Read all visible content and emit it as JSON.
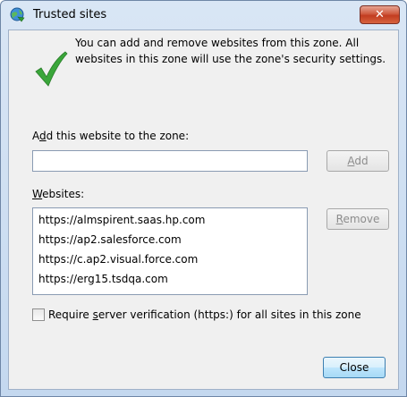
{
  "window": {
    "title": "Trusted sites",
    "close_glyph": "✕",
    "icon": "trusted-sites-globe-icon"
  },
  "info": {
    "icon": "green-checkmark-icon",
    "text": "You can add and remove websites from this zone. All websites in this zone will use the zone's security settings."
  },
  "add_section": {
    "label_accel": "d",
    "label_pre": "A",
    "label_post": "d this website to the zone:",
    "input_value": "",
    "add_button_pre": "",
    "add_button_accel": "A",
    "add_button_post": "dd"
  },
  "websites_section": {
    "label_accel": "W",
    "label_post": "ebsites:",
    "items": [
      "https://almspirent.saas.hp.com",
      "https://ap2.salesforce.com",
      "https://c.ap2.visual.force.com",
      "https://erg15.tsdqa.com"
    ],
    "remove_button_accel": "R",
    "remove_button_post": "emove"
  },
  "verify": {
    "checked": false,
    "label_pre": "Require ",
    "label_accel": "s",
    "label_post": "erver verification (https:) for all sites in this zone"
  },
  "footer": {
    "close_label": "Close"
  },
  "colors": {
    "accent_close": "#c23c20",
    "check_green": "#3aa63a"
  }
}
